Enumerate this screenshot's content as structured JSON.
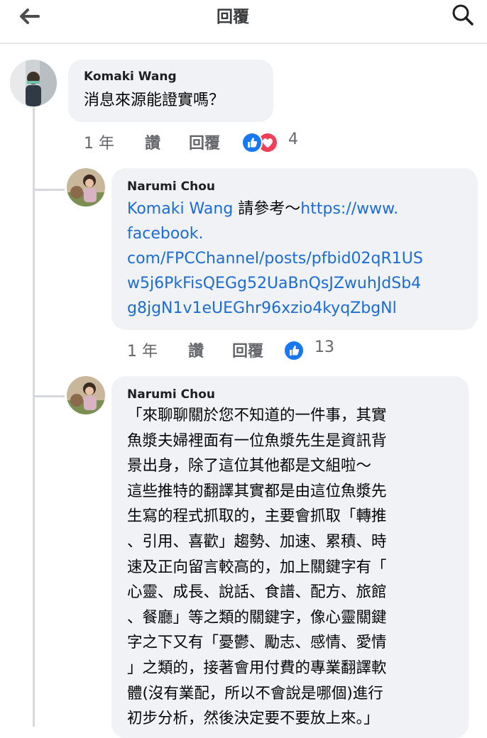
{
  "header": {
    "title": "回覆",
    "back_icon": "arrow-left-icon",
    "search_icon": "search-icon"
  },
  "comments": [
    {
      "author": "Komaki Wang",
      "text": "消息來源能證實嗎？",
      "meta": {
        "time": "1 年",
        "like_label": "讚",
        "reply_label": "回覆",
        "reaction_count": "4",
        "reactions": [
          "like-icon",
          "love-icon"
        ]
      }
    },
    {
      "author": "Narumi Chou",
      "mention": "Komaki Wang",
      "text_before_link": " 請參考～",
      "link_lines": [
        "https://www.",
        "facebook.",
        "com/FPCChannel/posts/pfbid02qR1US",
        "w5j6PkFisQEGg52UaBnQsJZwuhJdSb4",
        "g8jgN1v1eUEGhr96xzio4kyqZbgNl"
      ],
      "meta": {
        "time": "1 年",
        "like_label": "讚",
        "reply_label": "回覆",
        "reaction_count": "13",
        "reactions": [
          "like-icon"
        ]
      }
    },
    {
      "author": "Narumi Chou",
      "lines": [
        "「來聊聊關於您不知道的一件事，其實",
        "魚漿夫婦裡面有一位魚漿先生是資訊背",
        "景出身，除了這位其他都是文組啦～",
        "這些推特的翻譯其實都是由這位魚漿先",
        "生寫的程式抓取的，主要會抓取「轉推",
        "、引用、喜歡」趨勢、加速、累積、時",
        "速及正向留言較高的，加上關鍵字有「",
        "心靈、成長、說話、食譜、配方、旅館",
        "、餐廳」等之類的關鍵字，像心靈關鍵",
        "字之下又有「憂鬱、勵志、感情、愛情",
        "」之類的，接著會用付費的專業翻譯軟",
        "體(沒有業配，所以不會說是哪個)進行",
        "初步分析，然後決定要不要放上來。」"
      ]
    }
  ],
  "colors": {
    "link": "#1b6cd6",
    "bubble": "#f0f2f5",
    "meta": "#65676b",
    "like": "#1877f2",
    "love": "#f33e58"
  }
}
